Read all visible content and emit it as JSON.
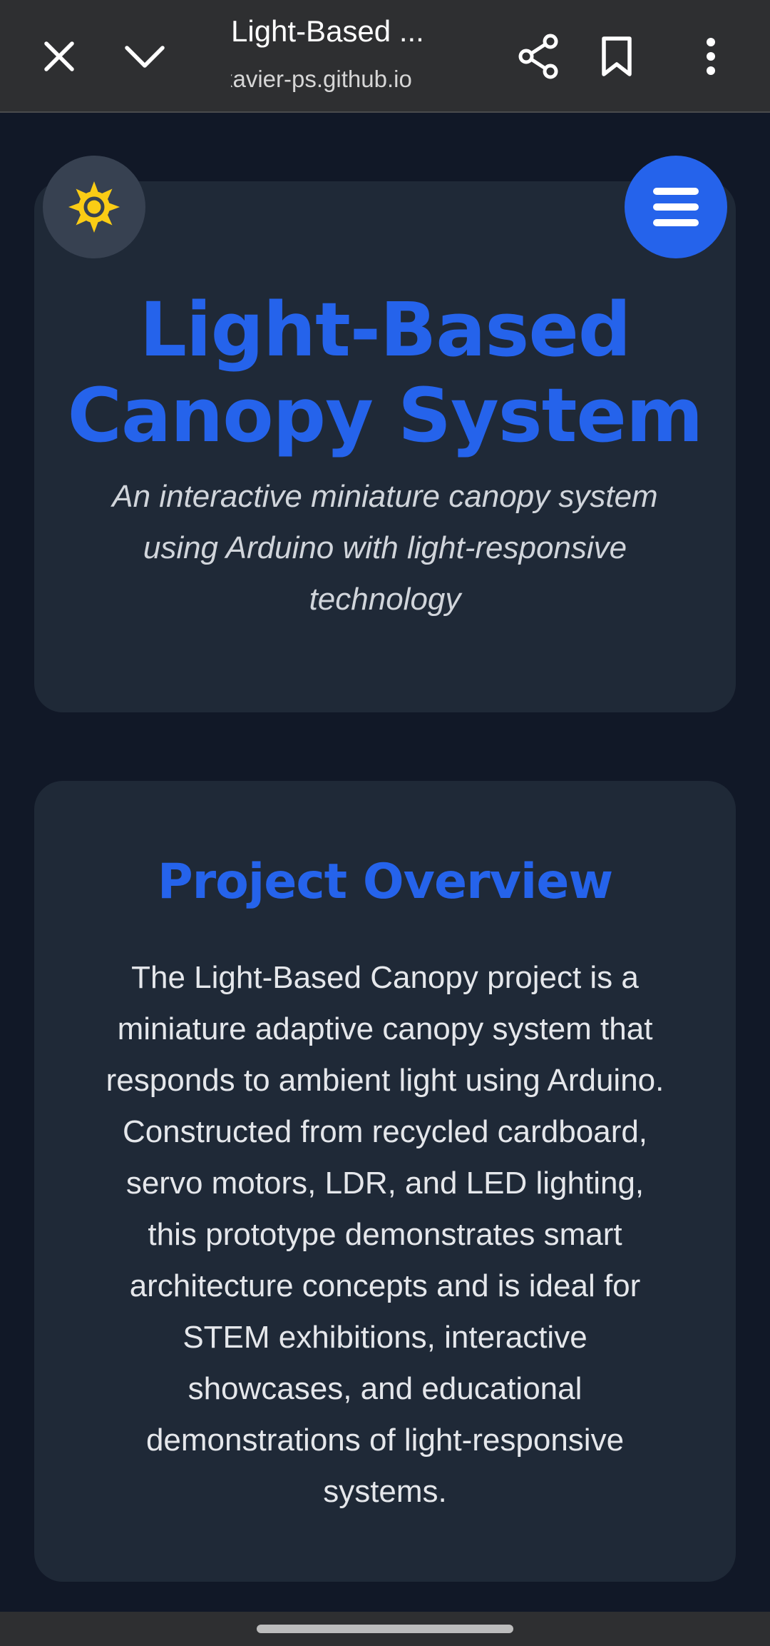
{
  "browser": {
    "tab_title": "Light-Based ...",
    "url": "xavier-ps.github.io",
    "icons": {
      "close": "close-icon",
      "collapse": "chevron-down-icon",
      "share": "share-icon",
      "bookmark": "bookmark-icon",
      "more": "more-vert-icon"
    }
  },
  "controls": {
    "theme_toggle_icon": "sun-icon",
    "menu_toggle_icon": "hamburger-menu-icon"
  },
  "hero": {
    "title": "Light-Based Canopy System",
    "subtitle": "An interactive miniature canopy system using Arduino with light-responsive technology"
  },
  "overview": {
    "heading": "Project Overview",
    "body": "The Light-Based Canopy project is a miniature adaptive canopy system that responds to ambient light using Arduino. Constructed from recycled cardboard, servo motors, LDR, and LED lighting, this prototype demonstrates smart architecture concepts and is ideal for STEM exhibitions, interactive showcases, and educational demonstrations of light-responsive systems."
  },
  "colors": {
    "accent": "#2563eb",
    "page_background": "#111827",
    "card_background": "#1f2937",
    "sun": "#facc15",
    "browser_bar": "#2e2f31"
  }
}
